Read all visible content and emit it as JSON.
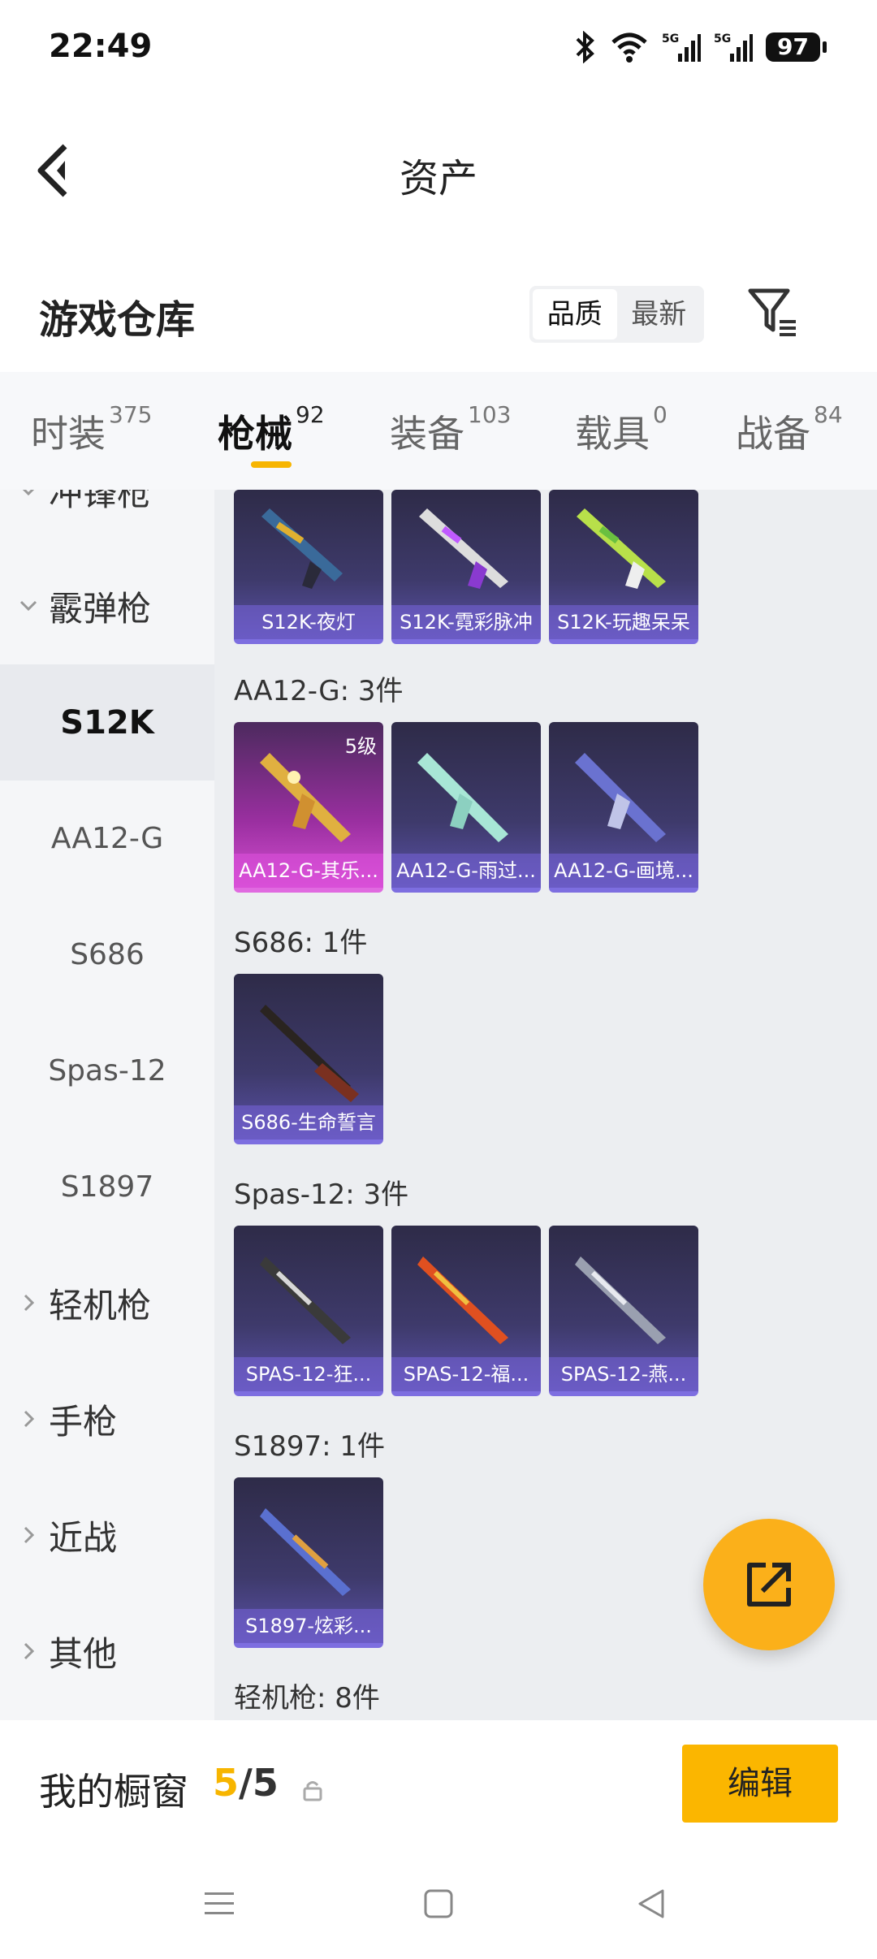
{
  "status": {
    "time": "22:49",
    "battery": "97"
  },
  "nav": {
    "title": "资产"
  },
  "section": {
    "title": "游戏仓库",
    "sort_quality": "品质",
    "sort_newest": "最新"
  },
  "tabs": [
    {
      "label": "时装",
      "count": "375"
    },
    {
      "label": "枪械",
      "count": "92"
    },
    {
      "label": "装备",
      "count": "103"
    },
    {
      "label": "载具",
      "count": "0"
    },
    {
      "label": "战备",
      "count": "84"
    }
  ],
  "sidebar": {
    "partial": "冲锋枪",
    "shotgun": "霰弹枪",
    "subs": [
      "S12K",
      "AA12-G",
      "S686",
      "Spas-12",
      "S1897"
    ],
    "lmg": "轻机枪",
    "pistol": "手枪",
    "melee": "近战",
    "other": "其他"
  },
  "groups": {
    "s12k": {
      "items": [
        "S12K-夜灯",
        "S12K-霓彩脉冲",
        "S12K-玩趣呆呆"
      ]
    },
    "aa12": {
      "label": "AA12-G: 3件",
      "level": "5级",
      "items": [
        "AA12-G-其乐...",
        "AA12-G-雨过...",
        "AA12-G-画境..."
      ]
    },
    "s686": {
      "label": "S686: 1件",
      "items": [
        "S686-生命誓言"
      ]
    },
    "spas": {
      "label": "Spas-12: 3件",
      "items": [
        "SPAS-12-狂...",
        "SPAS-12-福...",
        "SPAS-12-燕..."
      ]
    },
    "s1897": {
      "label": "S1897: 1件",
      "items": [
        "S1897-炫彩..."
      ]
    },
    "lmg": {
      "label": "轻机枪: 8件"
    }
  },
  "bottom": {
    "label": "我的橱窗",
    "current": "5",
    "sep": "/",
    "total": "5",
    "edit": "编辑"
  },
  "colors": {
    "accent": "#f7b500",
    "card": "#3e3a6b",
    "gold_card": "#c03fc0"
  }
}
